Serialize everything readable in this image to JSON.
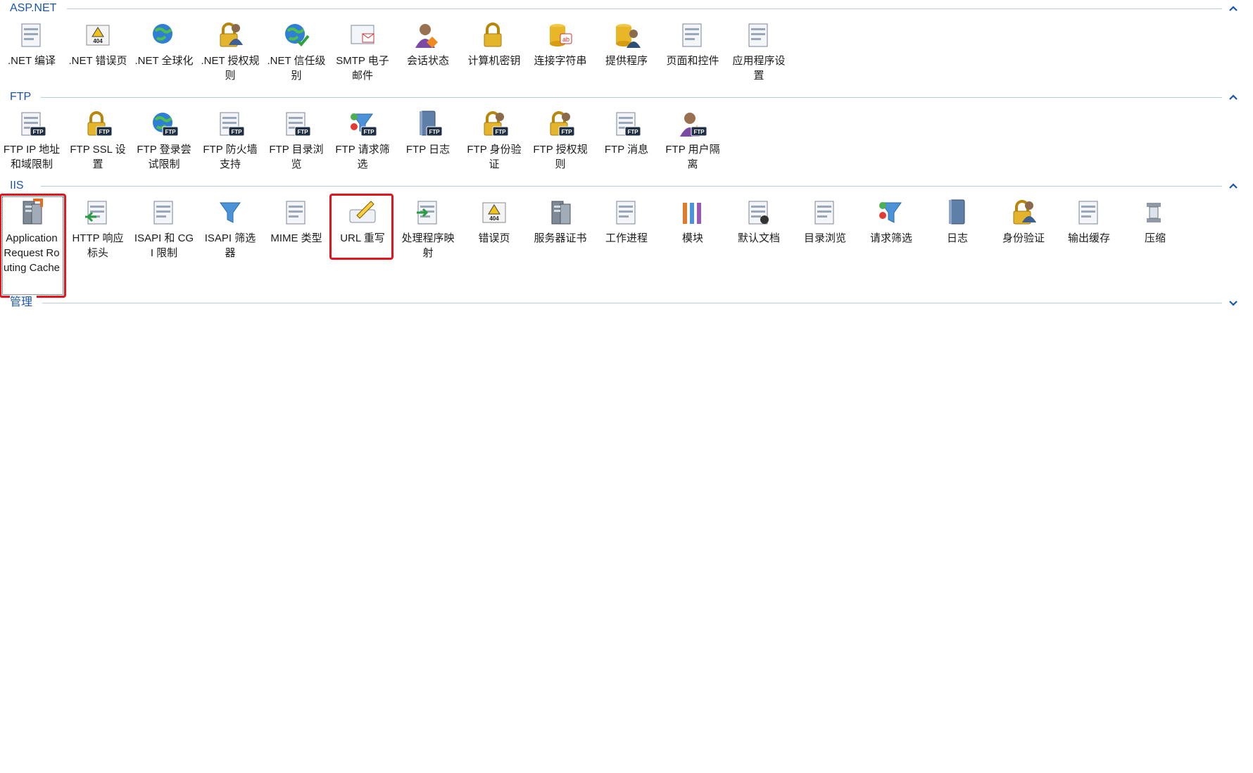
{
  "sections": [
    {
      "title": "ASP.NET",
      "collapse_glyph": "chevron-up-icon",
      "items": [
        {
          "label": ".NET 编译",
          "icon": "download-stack-icon"
        },
        {
          "label": ".NET 错误页",
          "icon": "error-page-404-icon"
        },
        {
          "label": ".NET 全球化",
          "icon": "globe-icon"
        },
        {
          "label": ".NET 授权规则",
          "icon": "auth-rules-lock-icon"
        },
        {
          "label": ".NET 信任级别",
          "icon": "trust-globe-check-icon"
        },
        {
          "label": "SMTP 电子邮件",
          "icon": "email-icon"
        },
        {
          "label": "会话状态",
          "icon": "session-state-user-icon"
        },
        {
          "label": "计算机密钥",
          "icon": "machine-key-server-icon"
        },
        {
          "label": "连接字符串",
          "icon": "connection-string-db-icon"
        },
        {
          "label": "提供程序",
          "icon": "providers-db-user-icon"
        },
        {
          "label": "页面和控件",
          "icon": "pages-controls-icon"
        },
        {
          "label": "应用程序设置",
          "icon": "app-settings-list-icon"
        }
      ]
    },
    {
      "title": "FTP",
      "collapse_glyph": "chevron-up-icon",
      "items": [
        {
          "label": "FTP IP 地址和域限制",
          "icon": "ftp-ip-restrict-icon"
        },
        {
          "label": "FTP SSL 设置",
          "icon": "ftp-ssl-lock-icon"
        },
        {
          "label": "FTP 登录尝试限制",
          "icon": "ftp-logon-globe-icon"
        },
        {
          "label": "FTP 防火墙支持",
          "icon": "ftp-firewall-icon"
        },
        {
          "label": "FTP 目录浏览",
          "icon": "ftp-dir-browse-icon"
        },
        {
          "label": "FTP 请求筛选",
          "icon": "ftp-request-filter-icon"
        },
        {
          "label": "FTP 日志",
          "icon": "ftp-log-book-icon"
        },
        {
          "label": "FTP 身份验证",
          "icon": "ftp-auth-user-lock-icon"
        },
        {
          "label": "FTP 授权规则",
          "icon": "ftp-auth-rules-key-icon"
        },
        {
          "label": "FTP 消息",
          "icon": "ftp-message-icon"
        },
        {
          "label": "FTP 用户隔离",
          "icon": "ftp-user-isolation-icon"
        }
      ]
    },
    {
      "title": "IIS",
      "collapse_glyph": "chevron-up-icon",
      "items": [
        {
          "label": "Application Request Routing Cache",
          "icon": "arr-cache-server-icon"
        },
        {
          "label": "HTTP 响应标头",
          "icon": "http-response-headers-icon"
        },
        {
          "label": "ISAPI 和 CGI 限制",
          "icon": "isapi-cgi-restrictions-icon"
        },
        {
          "label": "ISAPI 筛选器",
          "icon": "isapi-filter-funnel-icon"
        },
        {
          "label": "MIME 类型",
          "icon": "mime-types-icon"
        },
        {
          "label": "URL 重写",
          "icon": "url-rewrite-pen-icon"
        },
        {
          "label": "处理程序映射",
          "icon": "handler-mappings-icon"
        },
        {
          "label": "错误页",
          "icon": "error-pages-404-icon"
        },
        {
          "label": "服务器证书",
          "icon": "server-certificates-icon"
        },
        {
          "label": "工作进程",
          "icon": "worker-processes-icon"
        },
        {
          "label": "模块",
          "icon": "modules-icon"
        },
        {
          "label": "默认文档",
          "icon": "default-document-icon"
        },
        {
          "label": "目录浏览",
          "icon": "directory-browsing-icon"
        },
        {
          "label": "请求筛选",
          "icon": "request-filtering-icon"
        },
        {
          "label": "日志",
          "icon": "logging-book-icon"
        },
        {
          "label": "身份验证",
          "icon": "authentication-user-lock-icon"
        },
        {
          "label": "输出缓存",
          "icon": "output-caching-icon"
        },
        {
          "label": "压缩",
          "icon": "compression-clamp-icon"
        }
      ]
    },
    {
      "title": "管理",
      "collapse_glyph": "chevron-down-icon",
      "items": []
    }
  ],
  "colors": {
    "section_title": "#1a55a8",
    "section_line": "#b9cbe3",
    "highlight": "#e3141b",
    "label_text": "#1b1b1b"
  }
}
